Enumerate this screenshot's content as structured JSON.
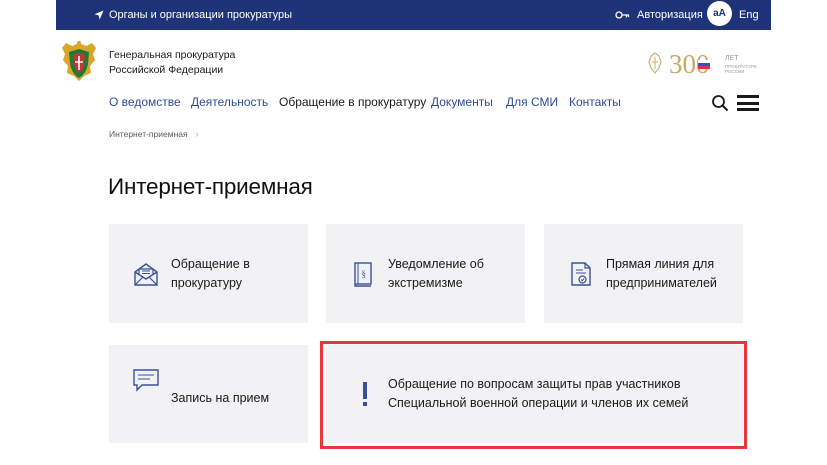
{
  "topbar": {
    "orgs_label": "Органы и организации прокуратуры",
    "auth_label": "Авторизация",
    "font_size_label": "аА",
    "lang_label": "Eng"
  },
  "header": {
    "org_name_line1": "Генеральная прокуратура",
    "org_name_line2": "Российской Федерации",
    "anniversary_number": "300",
    "anniversary_word": "ЛЕТ",
    "anniversary_caption1": "ПРОКУРАТУРЕ",
    "anniversary_caption2": "РОССИИ"
  },
  "nav": {
    "items": [
      {
        "label": "О ведомстве"
      },
      {
        "label": "Деятельность"
      },
      {
        "label": "Обращение в прокуратуру"
      },
      {
        "label": "Документы"
      },
      {
        "label": "Для СМИ"
      },
      {
        "label": "Контакты"
      }
    ]
  },
  "breadcrumb": {
    "item": "Интернет-приемная",
    "separator": "›"
  },
  "page": {
    "title": "Интернет-приемная"
  },
  "cards": [
    {
      "line1": "Обращение в",
      "line2": "прокуратуру"
    },
    {
      "line1": "Уведомление об",
      "line2": "экстремизме"
    },
    {
      "line1": "Прямая линия для",
      "line2": "предпринимателей"
    },
    {
      "line1": "Запись на прием",
      "line2": ""
    },
    {
      "line1": "Обращение по вопросам защиты прав участников",
      "line2": "Специальной военной операции и членов их семей"
    }
  ],
  "colors": {
    "topbar_bg": "#1f3378",
    "link": "#2f4a99",
    "icon": "#3a4f9a",
    "card_bg": "#f2f2f4",
    "highlight": "#e8363c"
  }
}
